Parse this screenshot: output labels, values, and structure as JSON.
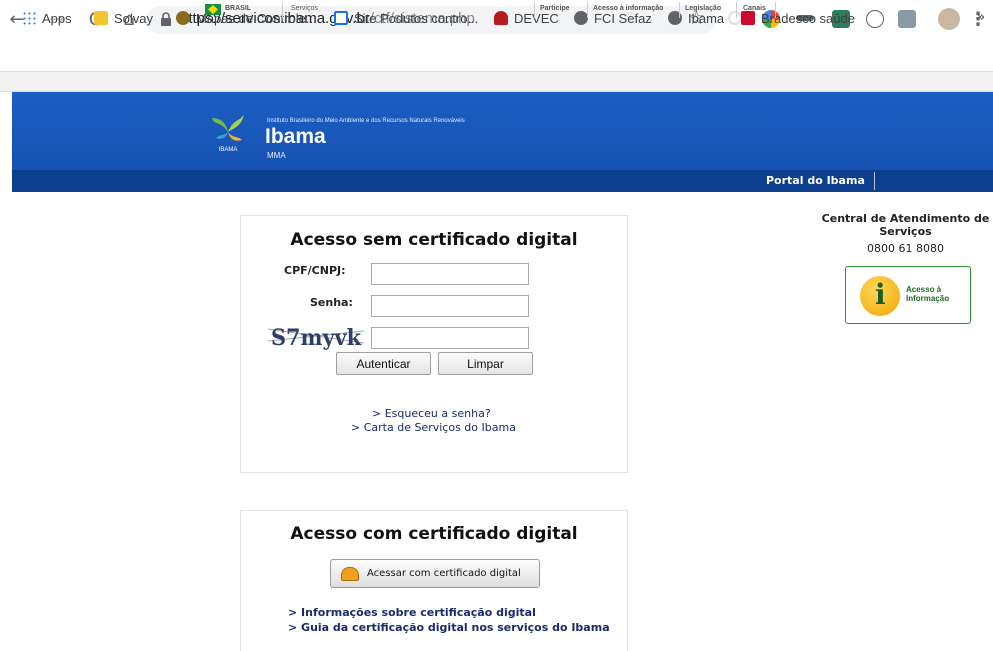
{
  "browser": {
    "url_host": "https://servicos.ibama.gov.br",
    "url_path": "/ctf/sistema.php",
    "bookmarks": [
      {
        "label": "Apps",
        "color": "#1a73e8"
      },
      {
        "label": "Solvay",
        "color": "#f4c430"
      },
      {
        "label": "Mapas de Controle...",
        "color": "#8a6d1b"
      },
      {
        "label": "Site Podutos contro...",
        "color": "#1a73e8"
      },
      {
        "label": "DEVEC",
        "color": "#b71c1c"
      },
      {
        "label": "FCI Sefaz",
        "color": "#5f6368"
      },
      {
        "label": "Ibama",
        "color": "#5f6368"
      },
      {
        "label": "Bradesco saúde",
        "color": "#cc092f"
      }
    ],
    "more": "»"
  },
  "govbar": {
    "brasil": "BRASIL",
    "servicos": "Serviços",
    "links": [
      "Participe",
      "Acesso à informação",
      "Legislação",
      "Canais"
    ]
  },
  "header": {
    "institute": "Instituto Brasileiro do Meio Ambiente e dos Recursos Naturais Renováveis",
    "brand": "Ibama",
    "ministry": "MMA",
    "logo_caption": "IBAMA",
    "portal_link": "Portal do Ibama"
  },
  "login": {
    "title": "Acesso sem certificado digital",
    "cpf_label": "CPF/CNPJ:",
    "senha_label": "Senha:",
    "captcha_text": "S7myvk",
    "authenticate_label": "Autenticar",
    "clear_label": "Limpar",
    "forgot_link": "> Esqueceu a senha?",
    "services_link": "> Carta de Serviços do Ibama"
  },
  "cert": {
    "title": "Acesso com certificado digital",
    "button_label": "Acessar com certificado digital",
    "info_link": "> Informações sobre certificação digital",
    "guide_link": "> Guia da certificação digital nos serviços do Ibama"
  },
  "side": {
    "central_line1": "Central de Atendimento de",
    "central_line2": "Serviços",
    "phone": "0800 61 8080",
    "acesso_line1": "Acesso à",
    "acesso_line2": "Informação"
  }
}
